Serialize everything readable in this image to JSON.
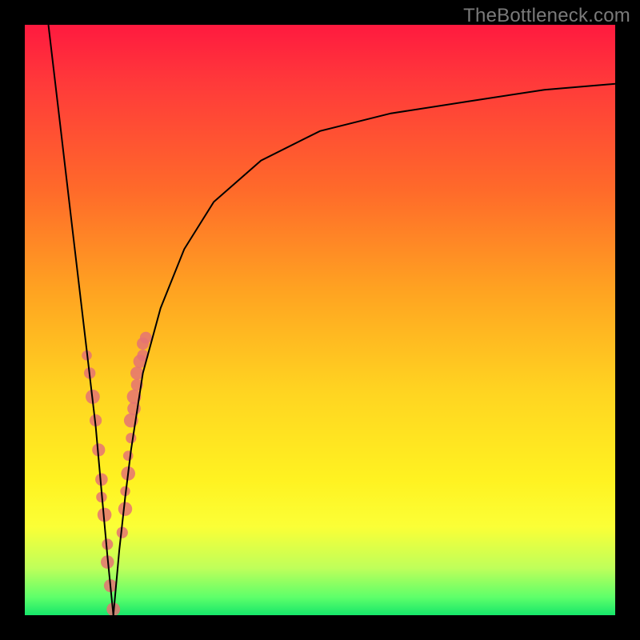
{
  "watermark": "TheBottleneck.com",
  "colors": {
    "frame": "#000000",
    "curve": "#000000",
    "dots": "#e57373",
    "gradient_top": "#ff1a3f",
    "gradient_bottom": "#16e66a"
  },
  "chart_data": {
    "type": "line",
    "title": "",
    "xlabel": "",
    "ylabel": "",
    "xlim": [
      0,
      100
    ],
    "ylim": [
      0,
      100
    ],
    "grid": false,
    "note": "Bottleneck-style V-curve. y is an abstract mismatch metric: 0 = no bottleneck (green band at bottom), 100 = severe bottleneck (red at top). Optimum (trough) sits near x≈15. Right branch is an asymptotic curve toward ~y≈90.",
    "series": [
      {
        "name": "left-branch",
        "x": [
          4,
          6,
          8,
          10,
          12,
          13,
          14,
          15
        ],
        "values": [
          100,
          83,
          66,
          49,
          32,
          21,
          10,
          0
        ]
      },
      {
        "name": "right-branch",
        "x": [
          15,
          16,
          17,
          18,
          20,
          23,
          27,
          32,
          40,
          50,
          62,
          75,
          88,
          100
        ],
        "values": [
          0,
          11,
          20,
          28,
          41,
          52,
          62,
          70,
          77,
          82,
          85,
          87,
          89,
          90
        ]
      }
    ],
    "scatter": {
      "name": "sample-points",
      "note": "Coral dots clustered along both branches near the trough, roughly y 0–45.",
      "x": [
        10.5,
        11,
        11.5,
        12,
        12.5,
        13,
        13,
        13.5,
        14,
        14,
        14.5,
        15,
        16.5,
        17,
        17,
        17.5,
        17.5,
        18,
        18,
        18.5,
        18.5,
        19,
        19,
        19.5,
        20,
        20,
        20.5
      ],
      "values": [
        44,
        41,
        37,
        33,
        28,
        23,
        20,
        17,
        12,
        9,
        5,
        1,
        14,
        18,
        21,
        24,
        27,
        30,
        33,
        35,
        37,
        39,
        41,
        43,
        44,
        46,
        47
      ]
    }
  }
}
